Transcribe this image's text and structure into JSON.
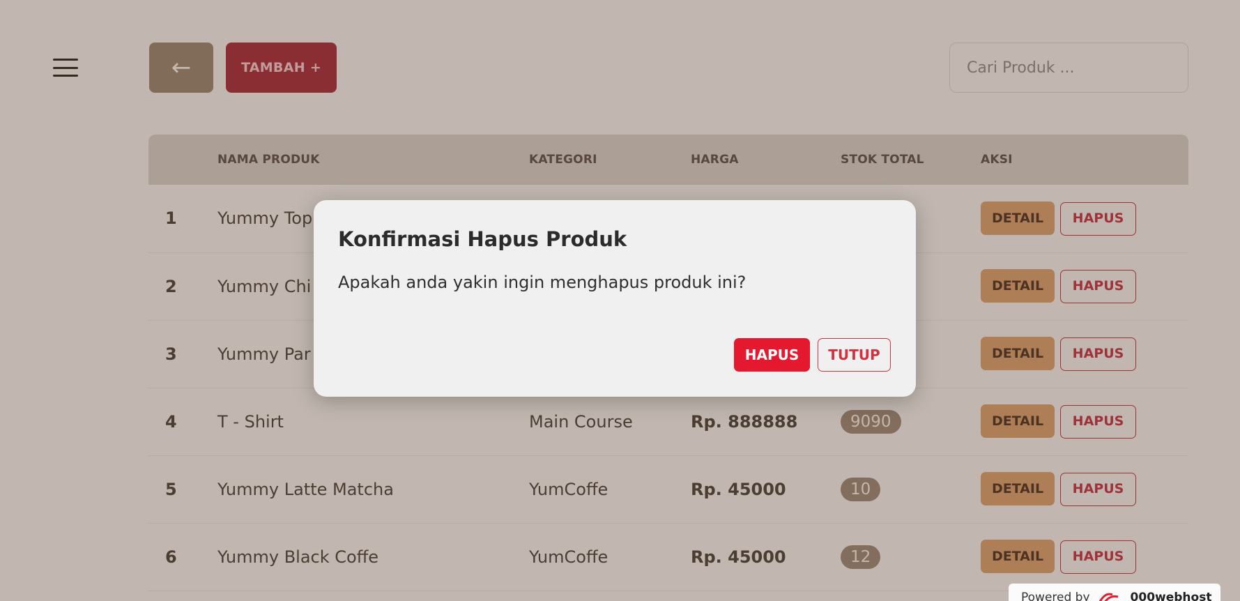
{
  "header": {
    "back_icon": "arrow-left-icon",
    "back_glyph": "←",
    "add_label": "TAMBAH +",
    "search_placeholder": "Cari Produk ..."
  },
  "table": {
    "columns": [
      "",
      "NAMA PRODUK",
      "KATEGORI",
      "HARGA",
      "STOK TOTAL",
      "AKSI"
    ],
    "rows": [
      {
        "no": "1",
        "name": "Yummy Top",
        "category": "",
        "price": "",
        "stock": ""
      },
      {
        "no": "2",
        "name": "Yummy Chi",
        "category": "",
        "price": "",
        "stock": ""
      },
      {
        "no": "3",
        "name": "Yummy Par",
        "category": "",
        "price": "",
        "stock": ""
      },
      {
        "no": "4",
        "name": "T - Shirt",
        "category": "Main Course",
        "price": "Rp. 888888",
        "stock": "9090"
      },
      {
        "no": "5",
        "name": "Yummy Latte Matcha",
        "category": "YumCoffe",
        "price": "Rp. 45000",
        "stock": "10"
      },
      {
        "no": "6",
        "name": "Yummy Black Coffe",
        "category": "YumCoffe",
        "price": "Rp. 45000",
        "stock": "12"
      }
    ],
    "detail_label": "DETAIL",
    "delete_label": "HAPUS"
  },
  "modal": {
    "title": "Konfirmasi Hapus Produk",
    "body": "Apakah anda yakin ingin menghapus produk ini?",
    "confirm_label": "HAPUS",
    "close_label": "TUTUP"
  },
  "footer": {
    "powered_text": "Powered by",
    "host_name": "000webhost"
  },
  "colors": {
    "accent_brown": "#97836f",
    "accent_red": "#a52a3a",
    "detail_button": "#d79c6c",
    "danger": "#e4182f"
  }
}
